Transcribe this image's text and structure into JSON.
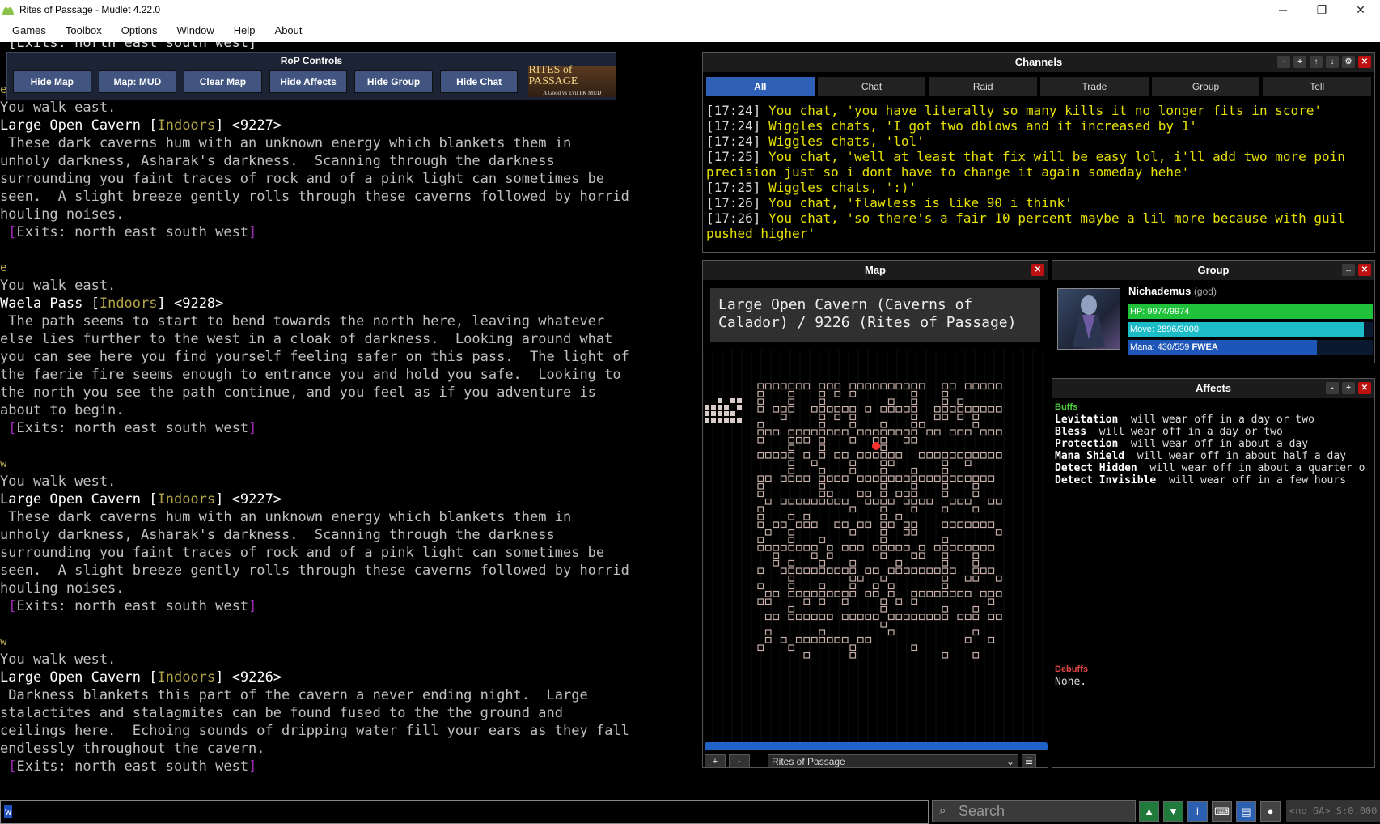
{
  "window": {
    "title": "Rites of Passage - Mudlet 4.22.0",
    "minimize": "─",
    "restore": "❐",
    "close": "✕"
  },
  "menu": [
    "Games",
    "Toolbox",
    "Options",
    "Window",
    "Help",
    "About"
  ],
  "console": {
    "ghost_line": " [Exits: north east south west]",
    "blocks": [
      {
        "cmd": "e",
        "walk": "You walk east.",
        "room": "Large Open Cavern",
        "indoors": "Indoors",
        "vnum": " <9227>",
        "desc": [
          " These dark caverns hum with an unknown energy which blankets them in",
          "unholy darkness, Asharak's darkness.  Scanning through the darkness",
          "surrounding you faint traces of rock and of a pink light can sometimes be",
          "seen.  A slight breeze gently rolls through these caverns followed by horrid",
          "houling noises."
        ],
        "exits": "Exits: north east south west"
      },
      {
        "cmd": "e",
        "walk": "You walk east.",
        "room": "Waela Pass",
        "indoors": "Indoors",
        "vnum": " <9228>",
        "desc": [
          " The path seems to start to bend towards the north here, leaving whatever",
          "else lies further to the west in a cloak of darkness.  Looking around what",
          "you can see here you find yourself feeling safer on this pass.  The light of",
          "the faerie fire seems enough to entrance you and hold you safe.  Looking to",
          "the north you see the path continue, and you feel as if you adventure is",
          "about to begin."
        ],
        "exits": "Exits: north east south west"
      },
      {
        "cmd": "w",
        "walk": "You walk west.",
        "room": "Large Open Cavern",
        "indoors": "Indoors",
        "vnum": " <9227>",
        "desc": [
          " These dark caverns hum with an unknown energy which blankets them in",
          "unholy darkness, Asharak's darkness.  Scanning through the darkness",
          "surrounding you faint traces of rock and of a pink light can sometimes be",
          "seen.  A slight breeze gently rolls through these caverns followed by horrid",
          "houling noises."
        ],
        "exits": "Exits: north east south west"
      },
      {
        "cmd": "w",
        "walk": "You walk west.",
        "room": "Large Open Cavern",
        "indoors": "Indoors",
        "vnum": " <9226>",
        "desc": [
          " Darkness blankets this part of the cavern a never ending night.  Large",
          "stalactites and stalagmites can be found fused to the the ground and",
          "ceilings here.  Echoing sounds of dripping water fill your ears as they fall",
          "endlessly throughout the cavern."
        ],
        "exits": "Exits: north east south west"
      }
    ]
  },
  "rop": {
    "title": "RoP Controls",
    "buttons": [
      "Hide Map",
      "Map: MUD",
      "Clear Map",
      "Hide Affects",
      "Hide Group",
      "Hide Chat"
    ],
    "logo_main": "RITES of PASSAGE",
    "logo_sub": "A Good vs Evil PK MUD"
  },
  "channels": {
    "title": "Channels",
    "tabs": [
      "All",
      "Chat",
      "Raid",
      "Trade",
      "Group",
      "Tell"
    ],
    "messages": [
      {
        "ts": "[17:24]",
        "text": " You chat, 'you have literally so many kills it no longer fits in score'"
      },
      {
        "ts": "[17:24]",
        "text": " Wiggles chats, 'I got two dblows and it increased by 1'"
      },
      {
        "ts": "[17:24]",
        "text": " Wiggles chats, 'lol'"
      },
      {
        "ts": "[17:25]",
        "text": " You chat, 'well at least that fix will be easy lol, i'll add two more poin"
      },
      {
        "ts": "",
        "text": "precision just so i dont have to change it again someday hehe'"
      },
      {
        "ts": "[17:25]",
        "text": " Wiggles chats, ':)'"
      },
      {
        "ts": "[17:26]",
        "text": " You chat, 'flawless is like 90 i think'"
      },
      {
        "ts": "[17:26]",
        "text": " You chat, 'so there's a fair 10 percent maybe a lil more because with guil"
      },
      {
        "ts": "",
        "text": "pushed higher'"
      }
    ]
  },
  "map": {
    "title": "Map",
    "info": "Large Open Cavern (Caverns of Calador) / 9226 (Rites of Passage)",
    "zoom_in": "+",
    "zoom_out": "-",
    "area": "Rites of Passage",
    "colors": {
      "room": "#c8b0a8",
      "player": "#ff3030",
      "bar": "#1e63c8"
    }
  },
  "group": {
    "title": "Group",
    "name": "Nichademus",
    "rank": "(god)",
    "hp": {
      "label": "HP: 9974/9974",
      "fraction": 1.0,
      "color": "#1fc23a"
    },
    "move": {
      "label": "Move: 2896/3000",
      "fraction": 0.965,
      "color": "#1cbdc9"
    },
    "mana": {
      "label": "Mana: 430/559",
      "flag": "FWEA",
      "fraction": 0.77,
      "color": "#1d56b8"
    }
  },
  "affects": {
    "title": "Affects",
    "buffs_label": "Buffs",
    "buffs": [
      {
        "name": "Levitation",
        "text": "  will wear off in a day or two"
      },
      {
        "name": "Bless",
        "text": "  will wear off in a day or two"
      },
      {
        "name": "Protection",
        "text": "  will wear off in about a day"
      },
      {
        "name": "Mana Shield",
        "text": "  will wear off in about half a day"
      },
      {
        "name": "Detect Hidden",
        "text": "  will wear off in about a quarter o"
      },
      {
        "name": "Detect Invisible",
        "text": "  will wear off in a few hours"
      }
    ],
    "debuffs_label": "Debuffs",
    "debuffs_text": "None."
  },
  "input": {
    "value": "w",
    "search_placeholder": "Search",
    "status": "<no GA> S:0.000"
  }
}
